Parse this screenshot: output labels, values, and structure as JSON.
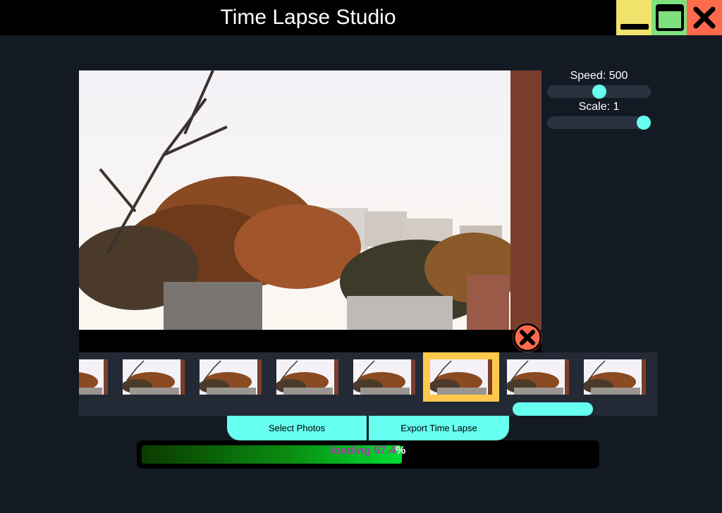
{
  "window": {
    "title": "Time Lapse Studio",
    "controls": [
      "minimize-icon",
      "maximize-icon",
      "close-icon"
    ]
  },
  "viewer": {
    "image_description_icon": "photo-preview",
    "remove_icon": "close-circle-icon"
  },
  "controls": {
    "speed_label": "Speed: 500",
    "speed_value": 500,
    "speed_fraction": 0.5,
    "scale_label": "Scale: 1",
    "scale_value": 1,
    "scale_fraction": 0.93
  },
  "filmstrip": {
    "thumb_count": 8,
    "selected_index": 5,
    "scroll_fraction": 0.75
  },
  "actions": {
    "select_label": "Select Photos",
    "export_label": "Export Time Lapse"
  },
  "progress": {
    "text": "loading 57.4",
    "suffix": "%",
    "value": 0.574
  },
  "colors": {
    "accent": "#66fff0",
    "minimize": "#f0e26a",
    "maximize": "#7fe07f",
    "close": "#ff6a4d",
    "selected": "#ffc94d",
    "background": "#141a24"
  }
}
